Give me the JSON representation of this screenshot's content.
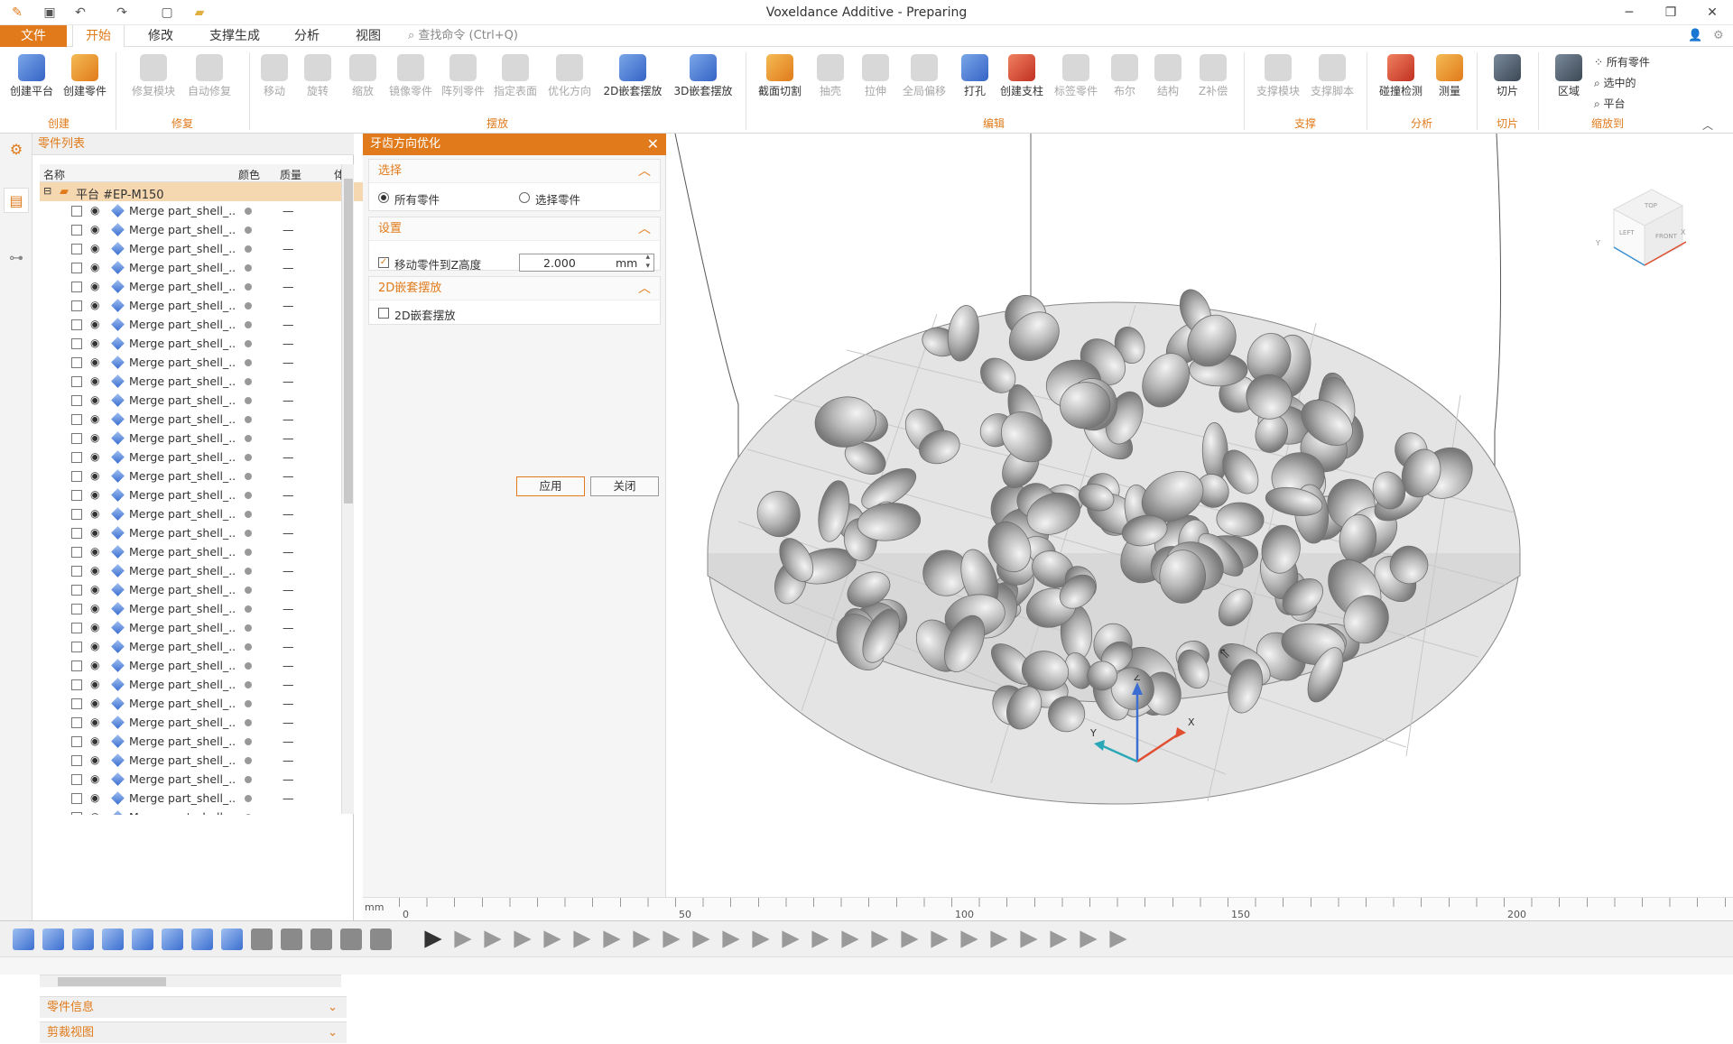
{
  "window": {
    "title": "Voxeldance Additive - Preparing"
  },
  "menu": {
    "file": "文件",
    "tabs": [
      "开始",
      "修改",
      "支撑生成",
      "分析",
      "视图"
    ],
    "search_placeholder": "查找命令 (Ctrl+Q)"
  },
  "ribbon": {
    "create": [
      "创建平台",
      "创建零件"
    ],
    "repair": [
      "修复模块",
      "自动修复"
    ],
    "place": [
      "移动",
      "旋转",
      "缩放",
      "镜像零件",
      "阵列零件",
      "指定表面",
      "优化方向",
      "2D嵌套摆放",
      "3D嵌套摆放"
    ],
    "edit": [
      "截面切割",
      "抽壳",
      "拉伸",
      "全局偏移",
      "打孔",
      "创建支柱",
      "标签零件",
      "布尔",
      "结构",
      "Z补偿"
    ],
    "support": [
      "支撑模块",
      "支撑脚本"
    ],
    "analysis": [
      "碰撞检测",
      "测量"
    ],
    "slice": [
      "切片"
    ],
    "zoom": [
      "区域",
      "所有零件",
      "选中的",
      "平台"
    ],
    "groups": [
      "创建",
      "修复",
      "摆放",
      "编辑",
      "支撑",
      "分析",
      "切片",
      "缩放到"
    ]
  },
  "partlist": {
    "header": "零件列表",
    "columns": [
      "名称",
      "颜色",
      "质量",
      "体"
    ],
    "platform": "平台 #EP-M150",
    "item_name": "Merge part_shell_...",
    "item_quality": "—",
    "item_count": 34,
    "sub_panels": [
      "零件信息",
      "剪裁视图"
    ]
  },
  "dialog": {
    "title": "牙齿方向优化",
    "sections": {
      "select": "选择",
      "settings": "设置",
      "nest2d": "2D嵌套摆放"
    },
    "radio_all": "所有零件",
    "radio_selected": "选择零件",
    "move_z_label": "移动零件到Z高度",
    "z_value": "2.000",
    "z_unit": "mm",
    "nest_label": "2D嵌套摆放",
    "apply": "应用",
    "close": "关闭"
  },
  "viewcube": {
    "top": "TOP",
    "left": "LEFT",
    "front": "FRONT",
    "x": "X",
    "y": "Y"
  },
  "axes": {
    "x": "X",
    "y": "Y",
    "z": "Z"
  },
  "ruler": {
    "unit": "mm",
    "ticks": [
      "0",
      "50",
      "100",
      "150",
      "200"
    ]
  },
  "colors": {
    "accent": "#e07a1a"
  }
}
